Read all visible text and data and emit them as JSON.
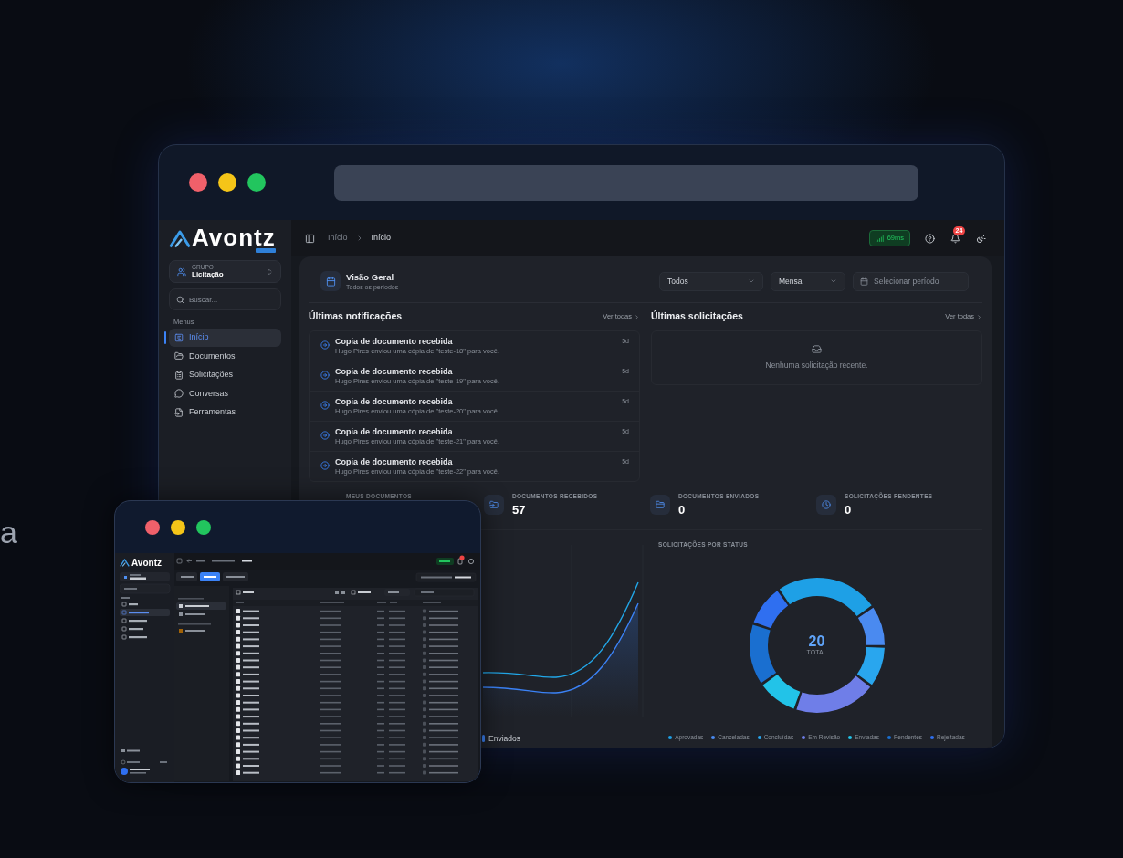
{
  "background_text": "a",
  "main_window": {
    "sidebar": {
      "logo": "Avontz",
      "group": {
        "label": "GRUPO",
        "value": "Licitação"
      },
      "search": {
        "placeholder": "Buscar..."
      },
      "section_label": "Menus",
      "items": [
        {
          "label": "Início",
          "selected": true
        },
        {
          "label": "Documentos",
          "selected": false
        },
        {
          "label": "Solicitações",
          "selected": false
        },
        {
          "label": "Conversas",
          "selected": false
        },
        {
          "label": "Ferramentas",
          "selected": false
        }
      ]
    },
    "header": {
      "breadcrumb": [
        "Início",
        "Início"
      ],
      "latency": "69ms",
      "notification_count": "24"
    },
    "overview": {
      "title": "Visão Geral",
      "subtitle": "Todos os períodos",
      "filters": [
        {
          "kind": "select",
          "value": "Todos"
        },
        {
          "kind": "select",
          "value": "Mensal"
        },
        {
          "kind": "date",
          "placeholder": "Selecionar período"
        }
      ]
    },
    "notifications": {
      "title": "Últimas notificações",
      "link": "Ver todas",
      "items": [
        {
          "title": "Copia de documento recebida",
          "message": "Hugo Pires enviou uma cópia de \"teste-18\" para você.",
          "age": "5d"
        },
        {
          "title": "Copia de documento recebida",
          "message": "Hugo Pires enviou uma cópia de \"teste-19\" para você.",
          "age": "5d"
        },
        {
          "title": "Copia de documento recebida",
          "message": "Hugo Pires enviou uma cópia de \"teste-20\" para você.",
          "age": "5d"
        },
        {
          "title": "Copia de documento recebida",
          "message": "Hugo Pires enviou uma cópia de \"teste-21\" para você.",
          "age": "5d"
        },
        {
          "title": "Copia de documento recebida",
          "message": "Hugo Pires enviou uma cópia de \"teste-22\" para você.",
          "age": "5d"
        }
      ]
    },
    "requests": {
      "title": "Últimas solicitações",
      "link": "Ver todas",
      "empty_message": "Nenhuma solicitação recente."
    },
    "stats": [
      {
        "label": "MEUS DOCUMENTOS"
      },
      {
        "label": "DOCUMENTOS RECEBIDOS",
        "value": "57"
      },
      {
        "label": "DOCUMENTOS ENVIADOS",
        "value": "0"
      },
      {
        "label": "SOLICITAÇÕES PENDENTES",
        "value": "0"
      }
    ],
    "activity_chart": {
      "legend": [
        "Enviados"
      ]
    },
    "status_chart": {
      "title": "SOLICITAÇÕES POR STATUS",
      "total": "20",
      "total_label": "TOTAL",
      "chart_data": {
        "type": "donut",
        "categories": [
          "Aprovadas",
          "Canceladas",
          "Concluídas",
          "Em Revisão",
          "Enviadas",
          "Pendentes",
          "Rejeitadas"
        ],
        "values": [
          25,
          10,
          10,
          20,
          10,
          15,
          10
        ],
        "colors": [
          "#1ea0e6",
          "#4a8af0",
          "#29a6ee",
          "#6f7ee8",
          "#22c3e8",
          "#1a6fd0",
          "#2f6ff0"
        ]
      }
    }
  },
  "preview_window": {
    "logo": "Avontz"
  }
}
